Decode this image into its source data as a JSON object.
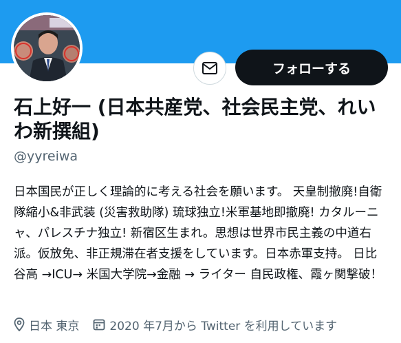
{
  "profile": {
    "display_name": "石上好一 (日本共産党、社会民主党、れいわ新撰組)",
    "handle": "@yyreiwa",
    "bio": "日本国民が正しく理論的に考える社会を願います。 天皇制撤廃!自衛隊縮小&非武装 (災害救助隊) 琉球独立!米軍基地即撤廃! カタルーニャ、パレスチナ独立! 新宿区生まれ。思想は世界市民主義の中道右派。仮放免、非正規滞在者支援をしています。日本赤軍支持。 日比谷高 →ICU→ 米国大学院→金融 → ライター 自民政権、霞ヶ関撃破！",
    "location": "日本 東京",
    "joined": "2020 年7月から Twitter を利用しています"
  },
  "actions": {
    "follow_label": "フォローする",
    "message_icon": "envelope-icon"
  },
  "colors": {
    "banner": "#1d9bf0",
    "follow_bg": "#0f1419",
    "secondary_text": "#536471"
  }
}
